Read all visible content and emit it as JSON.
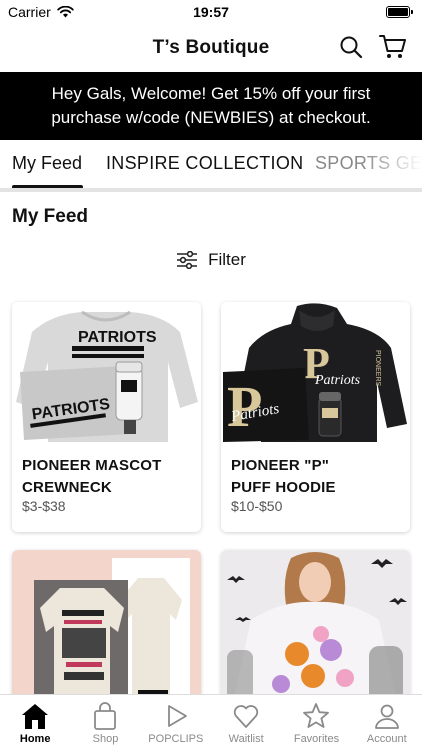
{
  "status_bar": {
    "carrier": "Carrier",
    "time": "19:57"
  },
  "header": {
    "title": "T’s Boutique"
  },
  "banner": {
    "line1": "Hey Gals, Welcome! Get 15% off your first",
    "line2": "purchase w/code (NEWBIES) at checkout."
  },
  "tabs": [
    {
      "label": "My Feed",
      "active": true
    },
    {
      "label": "INSPIRE COLLECTION",
      "active": false
    },
    {
      "label": "SPORTS GE",
      "active": false
    }
  ],
  "section": {
    "title": "My Feed",
    "filter_label": "Filter"
  },
  "products": [
    {
      "name_line1": "PIONEER MASCOT",
      "name_line2": "CREWNECK",
      "price": "$3-$38"
    },
    {
      "name_line1": "PIONEER \"P\"",
      "name_line2": "PUFF HOODIE",
      "price": "$10-$50"
    },
    {
      "name_line1": "",
      "name_line2": "",
      "price": ""
    },
    {
      "name_line1": "",
      "name_line2": "",
      "price": ""
    }
  ],
  "product_image_text": {
    "sweatshirt_top": "PATRIOTS",
    "sweatshirt_bottom": "PATRIOTS",
    "hoodie_script": "Patriots",
    "hoodie_sleeve": "PIONEERS",
    "hoodie_letter": "P"
  },
  "tabbar": [
    {
      "label": "Home",
      "icon": "home-icon",
      "active": true
    },
    {
      "label": "Shop",
      "icon": "shopping-bag-icon",
      "active": false
    },
    {
      "label": "POPCLIPS",
      "icon": "play-icon",
      "active": false
    },
    {
      "label": "Waitlist",
      "icon": "heart-icon",
      "active": false
    },
    {
      "label": "Favorites",
      "icon": "star-icon",
      "active": false
    },
    {
      "label": "Account",
      "icon": "person-icon",
      "active": false
    }
  ],
  "colors": {
    "banner_bg": "#000000",
    "accent_gold": "#d8c79a",
    "tab_inactive": "#8a8a8a"
  }
}
